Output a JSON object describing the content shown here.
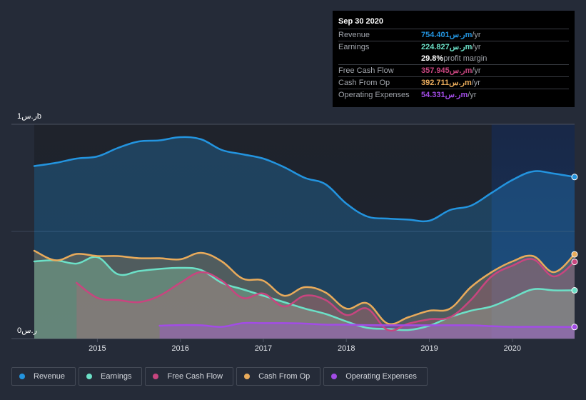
{
  "tooltip": {
    "date": "Sep 30 2020",
    "rows": [
      {
        "label": "Revenue",
        "value": "754.401ر.سm",
        "unit": " /yr",
        "color": "#2394df"
      },
      {
        "label": "Earnings",
        "value": "224.827ر.سm",
        "unit": " /yr",
        "color": "#6ce0c7"
      },
      {
        "label": "",
        "value": "29.8%",
        "unit": " profit margin",
        "color": "#ffffff"
      },
      {
        "label": "Free Cash Flow",
        "value": "357.945ر.سm",
        "unit": " /yr",
        "color": "#c8457f"
      },
      {
        "label": "Cash From Op",
        "value": "392.711ر.سm",
        "unit": " /yr",
        "color": "#e9ab5b"
      },
      {
        "label": "Operating Expenses",
        "value": "54.331ر.سm",
        "unit": " /yr",
        "color": "#a24ce6"
      }
    ]
  },
  "legend": [
    {
      "label": "Revenue",
      "color": "#2394df"
    },
    {
      "label": "Earnings",
      "color": "#6ce0c7"
    },
    {
      "label": "Free Cash Flow",
      "color": "#c8457f"
    },
    {
      "label": "Cash From Op",
      "color": "#e9ab5b"
    },
    {
      "label": "Operating Expenses",
      "color": "#a24ce6"
    }
  ],
  "chart_data": {
    "type": "area",
    "title": "",
    "xlabel": "",
    "ylabel": "",
    "ylim": [
      0,
      1000
    ],
    "xlim": [
      2014.24,
      2020.75
    ],
    "y_tick_labels": [
      "0ر.س",
      "1ر.سb"
    ],
    "x_tick_labels": [
      "2015",
      "2016",
      "2017",
      "2018",
      "2019",
      "2020"
    ],
    "x_ticks": [
      2015,
      2016,
      2017,
      2018,
      2019,
      2020
    ],
    "grid": true,
    "highlight_start": 2019.75,
    "series": [
      {
        "name": "Revenue",
        "color": "#2394df",
        "x": [
          2014.24,
          2014.5,
          2014.75,
          2015.0,
          2015.25,
          2015.5,
          2015.75,
          2016.0,
          2016.25,
          2016.5,
          2016.75,
          2017.0,
          2017.25,
          2017.5,
          2017.75,
          2018.0,
          2018.25,
          2018.5,
          2018.75,
          2019.0,
          2019.25,
          2019.5,
          2019.75,
          2020.0,
          2020.25,
          2020.5,
          2020.75
        ],
        "values": [
          805,
          820,
          840,
          850,
          890,
          920,
          925,
          940,
          930,
          880,
          860,
          840,
          800,
          750,
          720,
          630,
          570,
          560,
          555,
          550,
          600,
          620,
          680,
          740,
          780,
          770,
          754
        ]
      },
      {
        "name": "Earnings",
        "color": "#6ce0c7",
        "x": [
          2014.24,
          2014.5,
          2014.75,
          2015.0,
          2015.25,
          2015.5,
          2015.75,
          2016.0,
          2016.25,
          2016.5,
          2016.75,
          2017.0,
          2017.25,
          2017.5,
          2017.75,
          2018.0,
          2018.25,
          2018.5,
          2018.75,
          2019.0,
          2019.25,
          2019.5,
          2019.75,
          2020.0,
          2020.25,
          2020.5,
          2020.75
        ],
        "values": [
          360,
          365,
          350,
          380,
          300,
          315,
          325,
          330,
          320,
          260,
          230,
          200,
          170,
          140,
          115,
          80,
          50,
          45,
          40,
          60,
          100,
          130,
          150,
          190,
          230,
          225,
          225
        ]
      },
      {
        "name": "Free Cash Flow",
        "color": "#c8457f",
        "x": [
          2014.75,
          2015.0,
          2015.25,
          2015.5,
          2015.75,
          2016.0,
          2016.25,
          2016.5,
          2016.75,
          2017.0,
          2017.25,
          2017.5,
          2017.75,
          2018.0,
          2018.25,
          2018.5,
          2018.75,
          2019.0,
          2019.25,
          2019.5,
          2019.75,
          2020.0,
          2020.25,
          2020.5,
          2020.75
        ],
        "values": [
          260,
          190,
          180,
          170,
          200,
          260,
          310,
          270,
          190,
          210,
          150,
          200,
          180,
          110,
          140,
          40,
          70,
          90,
          100,
          180,
          290,
          340,
          370,
          290,
          358
        ]
      },
      {
        "name": "Cash From Op",
        "color": "#e9ab5b",
        "x": [
          2014.24,
          2014.5,
          2014.75,
          2015.0,
          2015.25,
          2015.5,
          2015.75,
          2016.0,
          2016.25,
          2016.5,
          2016.75,
          2017.0,
          2017.25,
          2017.5,
          2017.75,
          2018.0,
          2018.25,
          2018.5,
          2018.75,
          2019.0,
          2019.25,
          2019.5,
          2019.75,
          2020.0,
          2020.25,
          2020.5,
          2020.75
        ],
        "values": [
          410,
          365,
          395,
          385,
          385,
          375,
          375,
          370,
          400,
          360,
          280,
          270,
          200,
          240,
          215,
          140,
          165,
          70,
          100,
          130,
          140,
          240,
          310,
          360,
          385,
          310,
          393
        ]
      },
      {
        "name": "Operating Expenses",
        "color": "#a24ce6",
        "x": [
          2015.75,
          2016.0,
          2016.25,
          2016.5,
          2016.75,
          2017.0,
          2017.25,
          2017.5,
          2017.75,
          2018.0,
          2018.25,
          2018.5,
          2018.75,
          2019.0,
          2019.25,
          2019.5,
          2019.75,
          2020.0,
          2020.25,
          2020.5,
          2020.75
        ],
        "values": [
          60,
          63,
          62,
          55,
          72,
          72,
          72,
          70,
          65,
          65,
          63,
          62,
          62,
          62,
          62,
          62,
          58,
          55,
          55,
          55,
          54
        ]
      }
    ]
  }
}
